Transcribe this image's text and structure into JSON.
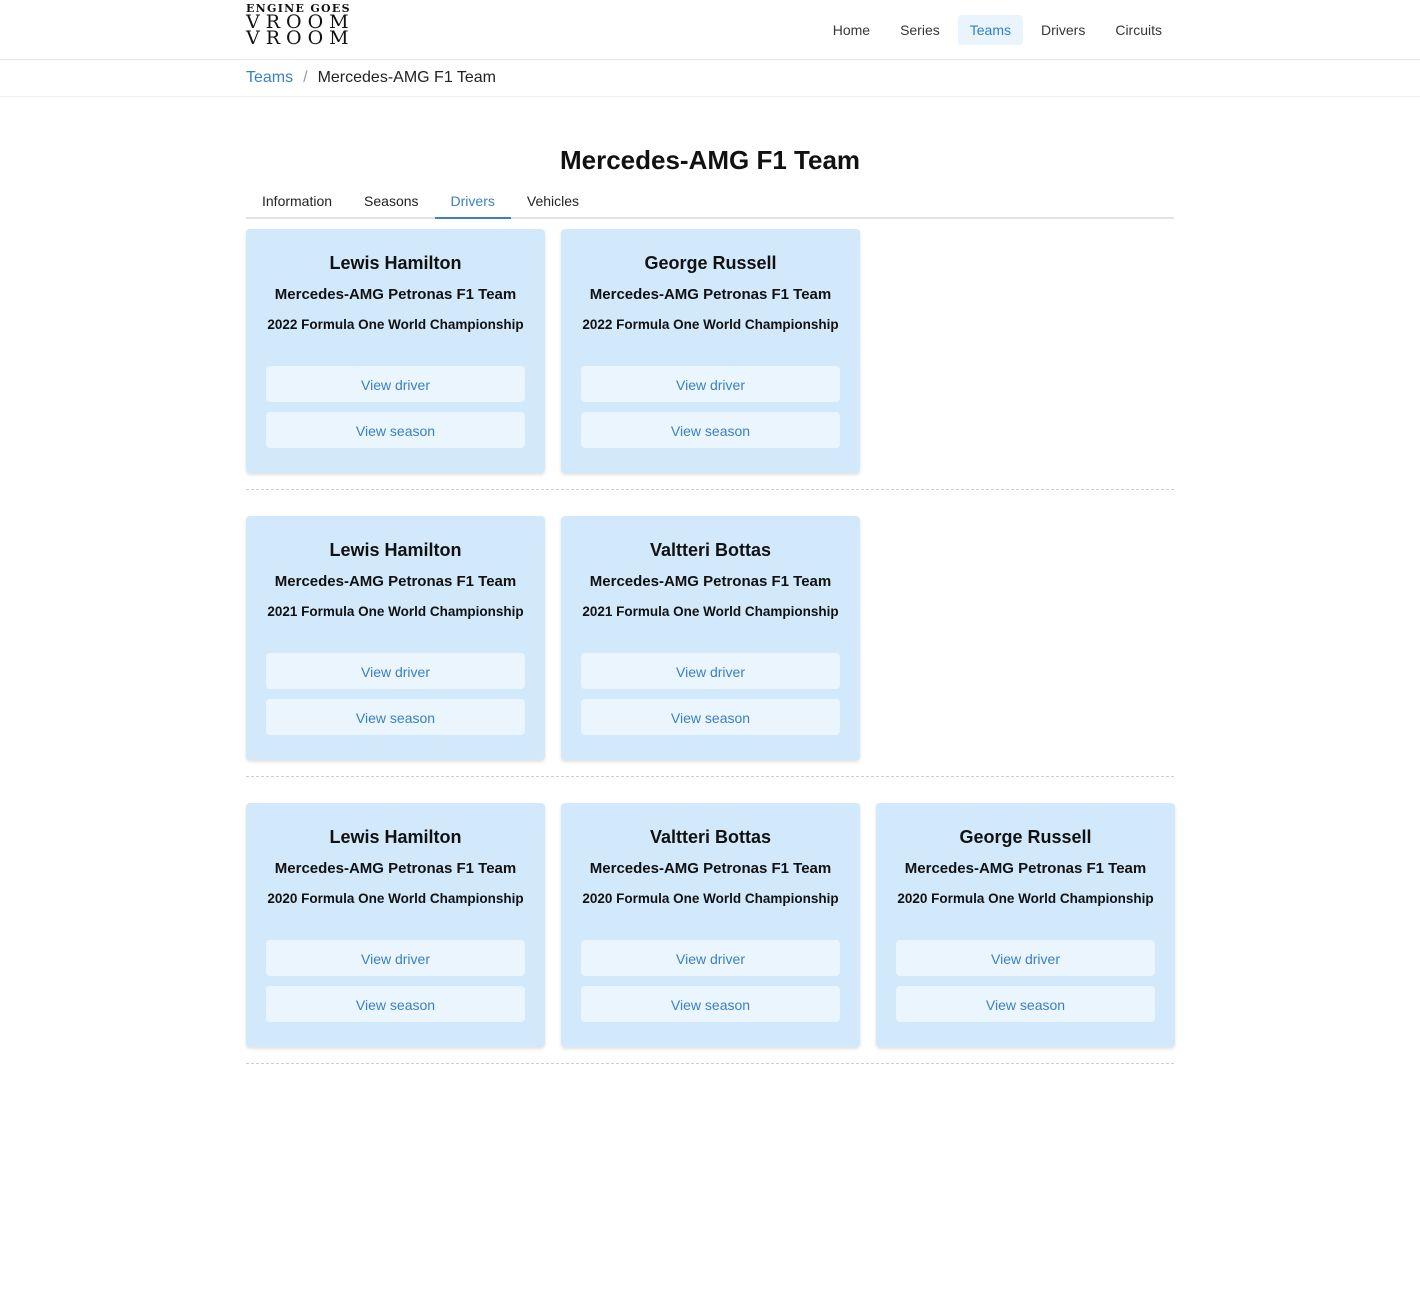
{
  "logo": {
    "line1": "ENGINE GOES",
    "line2": "VROOM",
    "line3": "VROOM"
  },
  "nav": [
    {
      "label": "Home",
      "active": false
    },
    {
      "label": "Series",
      "active": false
    },
    {
      "label": "Teams",
      "active": true
    },
    {
      "label": "Drivers",
      "active": false
    },
    {
      "label": "Circuits",
      "active": false
    }
  ],
  "breadcrumb": {
    "parent": "Teams",
    "separator": "/",
    "current": "Mercedes-AMG F1 Team"
  },
  "page_title": "Mercedes-AMG F1 Team",
  "tabs": [
    {
      "label": "Information",
      "active": false
    },
    {
      "label": "Seasons",
      "active": false
    },
    {
      "label": "Drivers",
      "active": true
    },
    {
      "label": "Vehicles",
      "active": false
    }
  ],
  "buttons": {
    "view_driver": "View driver",
    "view_season": "View season"
  },
  "groups": [
    {
      "cards": [
        {
          "driver": "Lewis Hamilton",
          "team": "Mercedes-AMG Petronas F1 Team",
          "season": "2022 Formula One World Championship"
        },
        {
          "driver": "George Russell",
          "team": "Mercedes-AMG Petronas F1 Team",
          "season": "2022 Formula One World Championship"
        }
      ]
    },
    {
      "cards": [
        {
          "driver": "Lewis Hamilton",
          "team": "Mercedes-AMG Petronas F1 Team",
          "season": "2021 Formula One World Championship"
        },
        {
          "driver": "Valtteri Bottas",
          "team": "Mercedes-AMG Petronas F1 Team",
          "season": "2021 Formula One World Championship"
        }
      ]
    },
    {
      "cards": [
        {
          "driver": "Lewis Hamilton",
          "team": "Mercedes-AMG Petronas F1 Team",
          "season": "2020 Formula One World Championship"
        },
        {
          "driver": "Valtteri Bottas",
          "team": "Mercedes-AMG Petronas F1 Team",
          "season": "2020 Formula One World Championship"
        },
        {
          "driver": "George Russell",
          "team": "Mercedes-AMG Petronas F1 Team",
          "season": "2020 Formula One World Championship"
        }
      ]
    }
  ]
}
